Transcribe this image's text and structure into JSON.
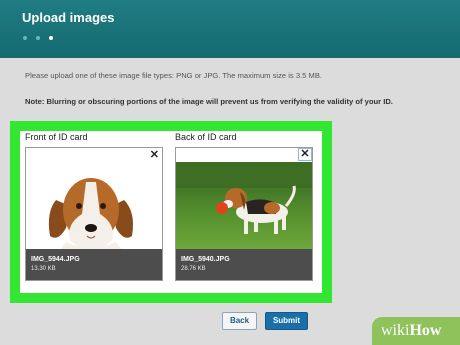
{
  "header": {
    "title": "Upload images",
    "steps": 3,
    "current_step": 3,
    "color": "#1b7479"
  },
  "instructions": {
    "text": "Please upload one of these image file types: PNG or JPG. The maximum size is 3.5 MB.",
    "note": "Note: Blurring or obscuring portions of the image will prevent us from verifying the validity of your ID."
  },
  "highlight_color": "#32e632",
  "cards": [
    {
      "label": "Front of ID card",
      "close": "✕",
      "file_name": "IMG_5944.JPG",
      "file_size": "13.30 KB"
    },
    {
      "label": "Back of ID card",
      "close": "✕",
      "file_name": "IMG_5940.JPG",
      "file_size": "28.76 KB"
    }
  ],
  "buttons": {
    "back": "Back",
    "submit": "Submit"
  },
  "watermark": {
    "prefix": "wiki",
    "suffix": "How"
  }
}
